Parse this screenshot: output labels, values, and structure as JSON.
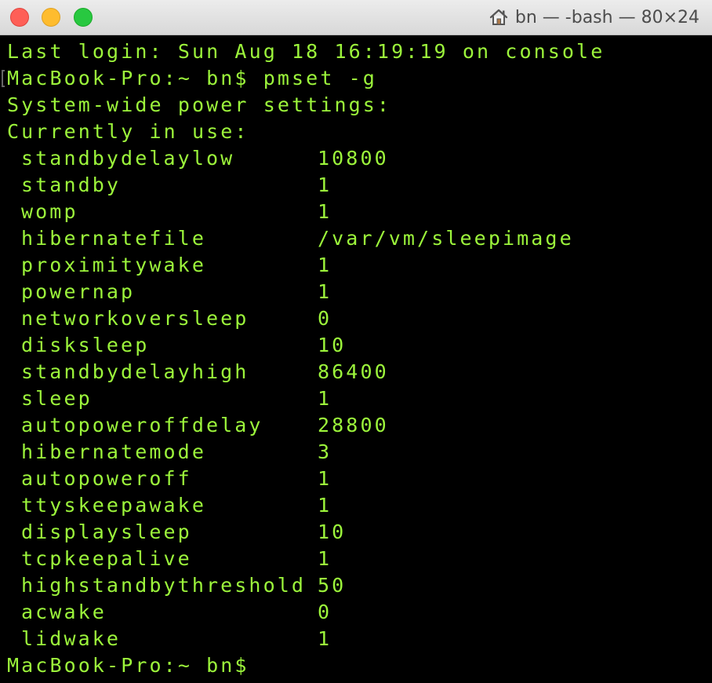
{
  "window": {
    "title": "bn — -bash — 80×24",
    "home_icon": "house-icon"
  },
  "terminal": {
    "last_login": "Last login: Sun Aug 18 16:19:19 on console",
    "command_line": "MacBook-Pro:~ bn$ pmset -g",
    "header1": "System-wide power settings:",
    "header2": "Currently in use:",
    "settings": [
      {
        "key": "standbydelaylow",
        "value": "10800"
      },
      {
        "key": "standby",
        "value": "1"
      },
      {
        "key": "womp",
        "value": "1"
      },
      {
        "key": "hibernatefile",
        "value": "/var/vm/sleepimage"
      },
      {
        "key": "proximitywake",
        "value": "1"
      },
      {
        "key": "powernap",
        "value": "1"
      },
      {
        "key": "networkoversleep",
        "value": "0"
      },
      {
        "key": "disksleep",
        "value": "10"
      },
      {
        "key": "standbydelayhigh",
        "value": "86400"
      },
      {
        "key": "sleep",
        "value": "1"
      },
      {
        "key": "autopoweroffdelay",
        "value": "28800"
      },
      {
        "key": "hibernatemode",
        "value": "3"
      },
      {
        "key": "autopoweroff",
        "value": "1"
      },
      {
        "key": "ttyskeepawake",
        "value": "1"
      },
      {
        "key": "displaysleep",
        "value": "10"
      },
      {
        "key": "tcpkeepalive",
        "value": "1"
      },
      {
        "key": "highstandbythreshold",
        "value": "50"
      },
      {
        "key": "acwake",
        "value": "0"
      },
      {
        "key": "lidwake",
        "value": "1"
      }
    ],
    "prompt": "MacBook-Pro:~ bn$",
    "text_color": "#9cf53b",
    "background_color": "#000000"
  }
}
